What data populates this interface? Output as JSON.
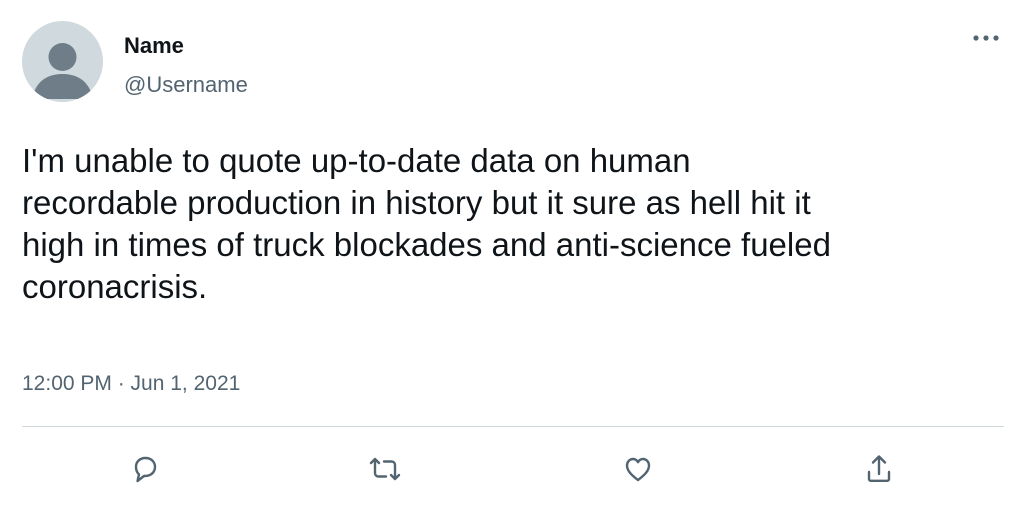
{
  "tweet": {
    "author_name": "Name",
    "author_handle": "@Username",
    "text": "I'm unable to quote up-to-date data on human\nrecordable production in history but it sure as hell hit it\nhigh in times of truck blockades and anti-science fueled\ncoronacrisis.",
    "timestamp": "12:00 PM · Jun 1, 2021"
  },
  "icons": {
    "avatar": "default-avatar-icon",
    "more": "more-options-icon",
    "reply": "reply-icon",
    "retweet": "retweet-icon",
    "like": "like-icon",
    "share": "share-icon"
  },
  "colors": {
    "text_primary": "#0f1419",
    "text_secondary": "#536471",
    "avatar_bg": "#cfd9de",
    "avatar_fg": "#6e7d88",
    "divider": "#cfd9de"
  }
}
